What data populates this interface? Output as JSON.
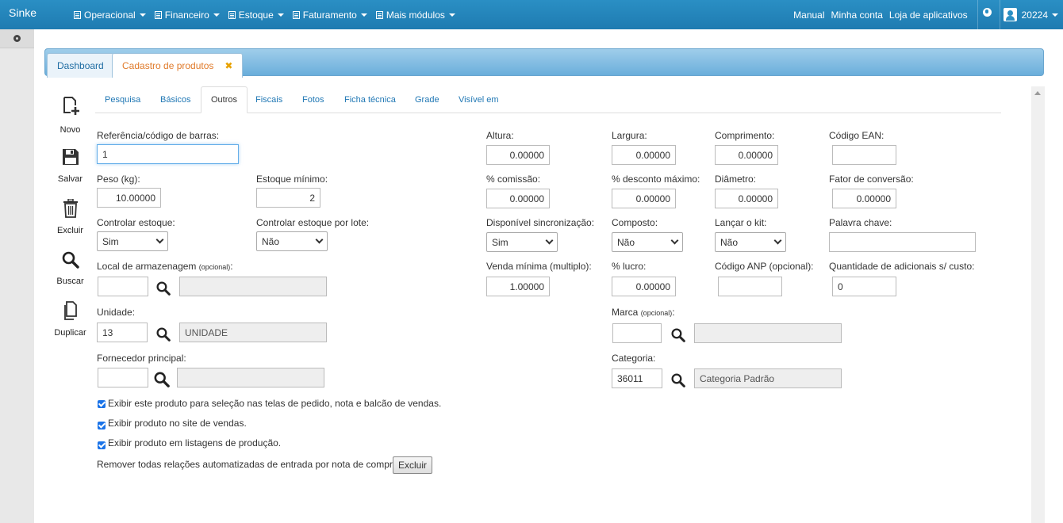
{
  "navbar": {
    "brand": "Sinke",
    "menu": [
      {
        "label": "Operacional"
      },
      {
        "label": "Financeiro"
      },
      {
        "label": "Estoque"
      },
      {
        "label": "Faturamento"
      },
      {
        "label": "Mais módulos"
      }
    ],
    "links": {
      "manual": "Manual",
      "account": "Minha conta",
      "store": "Loja de aplicativos"
    },
    "user": "20224"
  },
  "tabs": {
    "dashboard": "Dashboard",
    "product": "Cadastro de produtos",
    "close": "✖"
  },
  "toolbar": {
    "new": "Novo",
    "save": "Salvar",
    "delete": "Excluir",
    "search": "Buscar",
    "duplicate": "Duplicar"
  },
  "inner_tabs": [
    "Pesquisa",
    "Básicos",
    "Outros",
    "Fiscais",
    "Fotos",
    "Ficha técnica",
    "Grade",
    "Visível em"
  ],
  "form": {
    "ref_label": "Referência/código de barras:",
    "ref_value": "1",
    "peso_label": "Peso (kg):",
    "peso_value": "10.00000",
    "estmin_label": "Estoque mínimo:",
    "estmin_value": "2",
    "ctrl_est_label": "Controlar estoque:",
    "ctrl_est_value": "Sim",
    "ctrl_lote_label": "Controlar estoque por lote:",
    "ctrl_lote_value": "Não",
    "local_label": "Local de armazenagem",
    "opcional": "(opcional)",
    "unidade_label": "Unidade:",
    "unidade_code": "13",
    "unidade_name": "UNIDADE",
    "fornecedor_label": "Fornecedor principal:",
    "altura_label": "Altura:",
    "altura_value": "0.00000",
    "largura_label": "Largura:",
    "largura_value": "0.00000",
    "comprimento_label": "Comprimento:",
    "comprimento_value": "0.00000",
    "ean_label": "Código EAN:",
    "comissao_label": "% comissão:",
    "comissao_value": "0.00000",
    "desconto_label": "% desconto máximo:",
    "desconto_value": "0.00000",
    "diametro_label": "Diâmetro:",
    "diametro_value": "0.00000",
    "fator_label": "Fator de conversão:",
    "fator_value": "0.00000",
    "disp_sync_label": "Disponível sincronização:",
    "disp_sync_value": "Sim",
    "composto_label": "Composto:",
    "composto_value": "Não",
    "lancar_kit_label": "Lançar o kit:",
    "lancar_kit_value": "Não",
    "palavra_label": "Palavra chave:",
    "venda_min_label": "Venda mínima (multiplo):",
    "venda_min_value": "1.00000",
    "lucro_label": "% lucro:",
    "lucro_value": "0.00000",
    "anp_label": "Código ANP (opcional):",
    "qtd_adic_label": "Quantidade de adicionais s/ custo:",
    "qtd_adic_value": "0",
    "marca_label": "Marca",
    "categoria_label": "Categoria:",
    "categoria_code": "36011",
    "categoria_name": "Categoria Padrão",
    "chk1": "Exibir este produto para seleção nas telas de pedido, nota e balcão de vendas.",
    "chk2": "Exibir produto no site de vendas.",
    "chk3": "Exibir produto em listagens de produção.",
    "remover_label": "Remover todas relações automatizadas de entrada por nota de compra",
    "excluir_btn": "Excluir"
  }
}
